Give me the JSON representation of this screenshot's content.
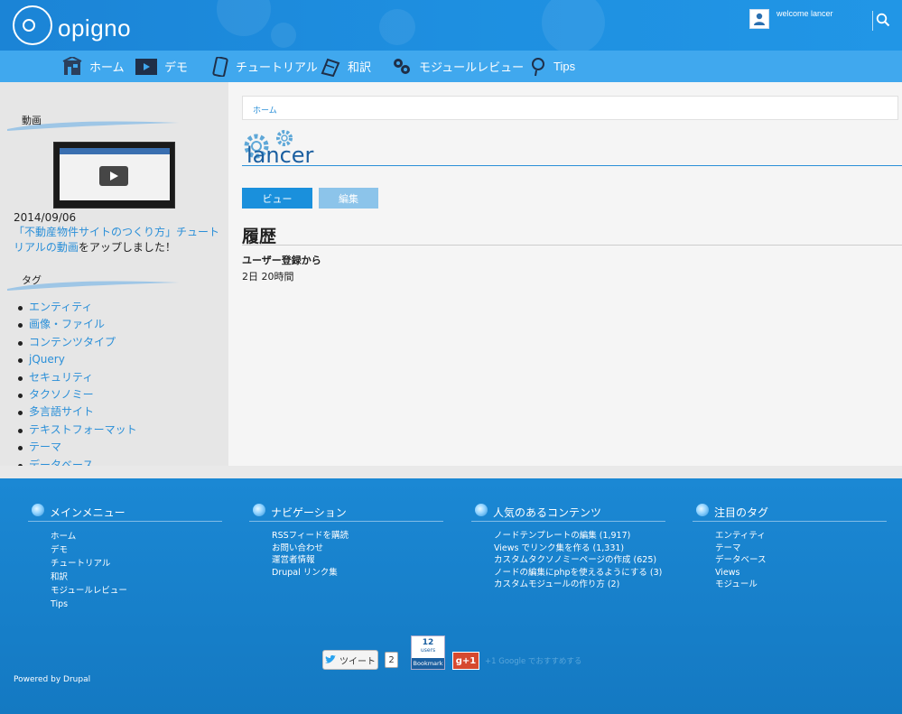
{
  "header": {
    "logo_text": "opigno",
    "welcome": "welcome lancer"
  },
  "nav": {
    "items": [
      {
        "label": "ホーム",
        "icon": "home-icon"
      },
      {
        "label": "デモ",
        "icon": "play-icon"
      },
      {
        "label": "チュートリアル",
        "icon": "phone-book-icon"
      },
      {
        "label": "和訳",
        "icon": "book-icon"
      },
      {
        "label": "モジュールレビュー",
        "icon": "module-icon"
      },
      {
        "label": "Tips",
        "icon": "lightbulb-icon"
      }
    ]
  },
  "sidebar": {
    "video_block_title": "動画",
    "post_date": "2014/09/06",
    "post_link": "「不動産物件サイトのつくり方」チュートリアルの動画",
    "post_suffix": "をアップしました！",
    "tags_block_title": "タグ",
    "tags": [
      "エンティティ",
      "画像・ファイル",
      "コンテンツタイプ",
      "jQuery",
      "セキュリティ",
      "タクソノミー",
      "多言語サイト",
      "テキストフォーマット",
      "テーマ",
      "データベース"
    ]
  },
  "main": {
    "breadcrumb": "ホーム",
    "page_title": "lancer",
    "tab_view": "ビュー",
    "tab_edit": "編集",
    "section_title": "履歴",
    "field_label": "ユーザー登録から",
    "field_value": "2日 20時間"
  },
  "footer": {
    "columns": [
      {
        "title": "メインメニュー",
        "items": [
          "ホーム",
          "デモ",
          "チュートリアル",
          "和訳",
          "モジュールレビュー",
          "Tips"
        ]
      },
      {
        "title": "ナビゲーション",
        "items": [
          "RSSフィードを購読",
          "お問い合わせ",
          "運営者情報",
          "Drupal リンク集"
        ]
      },
      {
        "title": "人気のあるコンテンツ",
        "items": [
          "ノードテンプレートの編集 (1,917)",
          "Views でリンク集を作る (1,331)",
          "カスタムタクソノミーページの作成 (625)",
          "ノードの編集にphpを使えるようにする (3)",
          "カスタムモジュールの作り方 (2)"
        ]
      },
      {
        "title": "注目のタグ",
        "items": [
          "エンティティ",
          "テーマ",
          "データベース",
          "Views",
          "モジュール"
        ]
      }
    ],
    "tweet_label": "ツイート",
    "tweet_count": "2",
    "bookmark_count": "12",
    "bookmark_users": "users",
    "bookmark_label": "Bookmark",
    "gplus_label": "g+1",
    "gplus_text": "+1 Google でおすすめする",
    "powered_by": "Powered by Drupal"
  }
}
